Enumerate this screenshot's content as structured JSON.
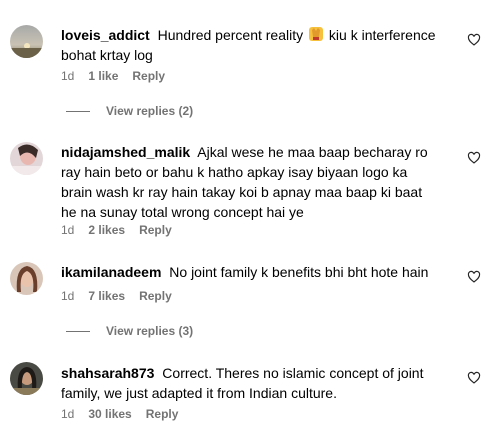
{
  "comments": [
    {
      "username": "loveis_addict",
      "text_before_emoji": "Hundred percent reality",
      "emoji": "raising-hands-emoji",
      "text_after_emoji": "kiu k interference bohat krtay log",
      "time": "1d",
      "likes": "1 like",
      "reply": "Reply",
      "view_replies": "View replies (2)"
    },
    {
      "username": "nidajamshed_malik",
      "text": "Ajkal wese he maa baap becharay ro ray hain beto or bahu k hatho apkay isay biyaan logo ka brain wash kr ray hain takay koi b apnay maa baap ki baat he na sunay total wrong concept hai ye",
      "time": "1d",
      "likes": "2 likes",
      "reply": "Reply"
    },
    {
      "username": "ikamilanadeem",
      "text": "No joint family k benefits bhi bht hote hain",
      "time": "1d",
      "likes": "7 likes",
      "reply": "Reply",
      "view_replies": "View replies (3)"
    },
    {
      "username": "shahsarah873",
      "text": "Correct. Theres no islamic concept of joint family, we just adapted it from Indian culture.",
      "time": "1d",
      "likes": "30 likes",
      "reply": "Reply"
    }
  ],
  "colors": {
    "text": "#000000",
    "muted": "#737373",
    "background": "#ffffff"
  },
  "icons": {
    "like": "heart-outline-icon"
  }
}
